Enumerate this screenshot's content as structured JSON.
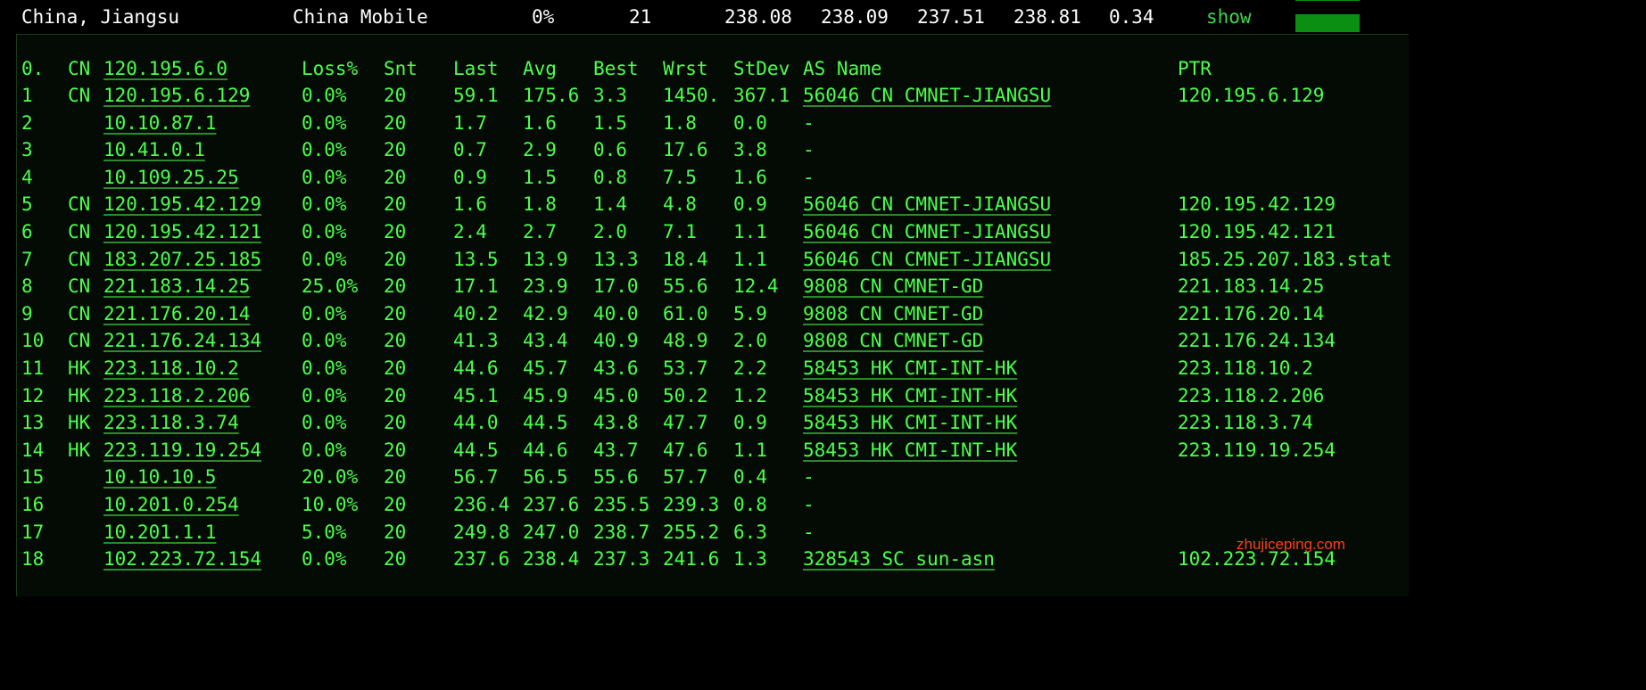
{
  "summary": {
    "location": "China, Jiangsu",
    "isp": "China Mobile",
    "loss": "0%",
    "sent": "21",
    "last": "238.08",
    "avg": "238.09",
    "best": "237.51",
    "worst": "238.81",
    "stdev": "0.34",
    "show_label": "show",
    "accent": "#0a8f13"
  },
  "headers": {
    "index": "0.",
    "cc": "CN",
    "host": "120.195.6.0",
    "loss": "Loss%",
    "snt": "Snt",
    "last": "Last",
    "avg": "Avg",
    "best": "Best",
    "wrst": "Wrst",
    "stdev": "StDev",
    "asname": "AS Name",
    "ptr": "PTR"
  },
  "hops": [
    {
      "index": "1",
      "cc": "CN",
      "host": "120.195.6.129",
      "loss": "0.0%",
      "snt": "20",
      "last": "59.1",
      "avg": "175.6",
      "best": "3.3",
      "wrst": "1450.",
      "stdev": "367.1",
      "asname": "56046 CN CMNET-JIANGSU",
      "ptr": "120.195.6.129"
    },
    {
      "index": "2",
      "cc": "",
      "host": "10.10.87.1",
      "loss": "0.0%",
      "snt": "20",
      "last": "1.7",
      "avg": "1.6",
      "best": "1.5",
      "wrst": "1.8",
      "stdev": "0.0",
      "asname": "-",
      "ptr": ""
    },
    {
      "index": "3",
      "cc": "",
      "host": "10.41.0.1",
      "loss": "0.0%",
      "snt": "20",
      "last": "0.7",
      "avg": "2.9",
      "best": "0.6",
      "wrst": "17.6",
      "stdev": "3.8",
      "asname": "-",
      "ptr": ""
    },
    {
      "index": "4",
      "cc": "",
      "host": "10.109.25.25",
      "loss": "0.0%",
      "snt": "20",
      "last": "0.9",
      "avg": "1.5",
      "best": "0.8",
      "wrst": "7.5",
      "stdev": "1.6",
      "asname": "-",
      "ptr": ""
    },
    {
      "index": "5",
      "cc": "CN",
      "host": "120.195.42.129",
      "loss": "0.0%",
      "snt": "20",
      "last": "1.6",
      "avg": "1.8",
      "best": "1.4",
      "wrst": "4.8",
      "stdev": "0.9",
      "asname": "56046 CN CMNET-JIANGSU",
      "ptr": "120.195.42.129"
    },
    {
      "index": "6",
      "cc": "CN",
      "host": "120.195.42.121",
      "loss": "0.0%",
      "snt": "20",
      "last": "2.4",
      "avg": "2.7",
      "best": "2.0",
      "wrst": "7.1",
      "stdev": "1.1",
      "asname": "56046 CN CMNET-JIANGSU",
      "ptr": "120.195.42.121"
    },
    {
      "index": "7",
      "cc": "CN",
      "host": "183.207.25.185",
      "loss": "0.0%",
      "snt": "20",
      "last": "13.5",
      "avg": "13.9",
      "best": "13.3",
      "wrst": "18.4",
      "stdev": "1.1",
      "asname": "56046 CN CMNET-JIANGSU",
      "ptr": "185.25.207.183.stat"
    },
    {
      "index": "8",
      "cc": "CN",
      "host": "221.183.14.25",
      "loss": "25.0%",
      "snt": "20",
      "last": "17.1",
      "avg": "23.9",
      "best": "17.0",
      "wrst": "55.6",
      "stdev": "12.4",
      "asname": "9808  CN CMNET-GD",
      "ptr": "221.183.14.25"
    },
    {
      "index": "9",
      "cc": "CN",
      "host": "221.176.20.14",
      "loss": "0.0%",
      "snt": "20",
      "last": "40.2",
      "avg": "42.9",
      "best": "40.0",
      "wrst": "61.0",
      "stdev": "5.9",
      "asname": "9808  CN CMNET-GD",
      "ptr": "221.176.20.14"
    },
    {
      "index": "10",
      "cc": "CN",
      "host": "221.176.24.134",
      "loss": "0.0%",
      "snt": "20",
      "last": "41.3",
      "avg": "43.4",
      "best": "40.9",
      "wrst": "48.9",
      "stdev": "2.0",
      "asname": "9808  CN CMNET-GD",
      "ptr": "221.176.24.134"
    },
    {
      "index": "11",
      "cc": "HK",
      "host": "223.118.10.2",
      "loss": "0.0%",
      "snt": "20",
      "last": "44.6",
      "avg": "45.7",
      "best": "43.6",
      "wrst": "53.7",
      "stdev": "2.2",
      "asname": "58453 HK CMI-INT-HK",
      "ptr": "223.118.10.2"
    },
    {
      "index": "12",
      "cc": "HK",
      "host": "223.118.2.206",
      "loss": "0.0%",
      "snt": "20",
      "last": "45.1",
      "avg": "45.9",
      "best": "45.0",
      "wrst": "50.2",
      "stdev": "1.2",
      "asname": "58453 HK CMI-INT-HK",
      "ptr": "223.118.2.206"
    },
    {
      "index": "13",
      "cc": "HK",
      "host": "223.118.3.74",
      "loss": "0.0%",
      "snt": "20",
      "last": "44.0",
      "avg": "44.5",
      "best": "43.8",
      "wrst": "47.7",
      "stdev": "0.9",
      "asname": "58453 HK CMI-INT-HK",
      "ptr": "223.118.3.74"
    },
    {
      "index": "14",
      "cc": "HK",
      "host": "223.119.19.254",
      "loss": "0.0%",
      "snt": "20",
      "last": "44.5",
      "avg": "44.6",
      "best": "43.7",
      "wrst": "47.6",
      "stdev": "1.1",
      "asname": "58453 HK CMI-INT-HK",
      "ptr": "223.119.19.254"
    },
    {
      "index": "15",
      "cc": "",
      "host": "10.10.10.5",
      "loss": "20.0%",
      "snt": "20",
      "last": "56.7",
      "avg": "56.5",
      "best": "55.6",
      "wrst": "57.7",
      "stdev": "0.4",
      "asname": "-",
      "ptr": ""
    },
    {
      "index": "16",
      "cc": "",
      "host": "10.201.0.254",
      "loss": "10.0%",
      "snt": "20",
      "last": "236.4",
      "avg": "237.6",
      "best": "235.5",
      "wrst": "239.3",
      "stdev": "0.8",
      "asname": "-",
      "ptr": ""
    },
    {
      "index": "17",
      "cc": "",
      "host": "10.201.1.1",
      "loss": "5.0%",
      "snt": "20",
      "last": "249.8",
      "avg": "247.0",
      "best": "238.7",
      "wrst": "255.2",
      "stdev": "6.3",
      "asname": "-",
      "ptr": ""
    },
    {
      "index": "18",
      "cc": "",
      "host": "102.223.72.154",
      "loss": "0.0%",
      "snt": "20",
      "last": "237.6",
      "avg": "238.4",
      "best": "237.3",
      "wrst": "241.6",
      "stdev": "1.3",
      "asname": "328543 SC sun-asn",
      "ptr": "102.223.72.154"
    }
  ],
  "watermark": "zhujiceping.com"
}
